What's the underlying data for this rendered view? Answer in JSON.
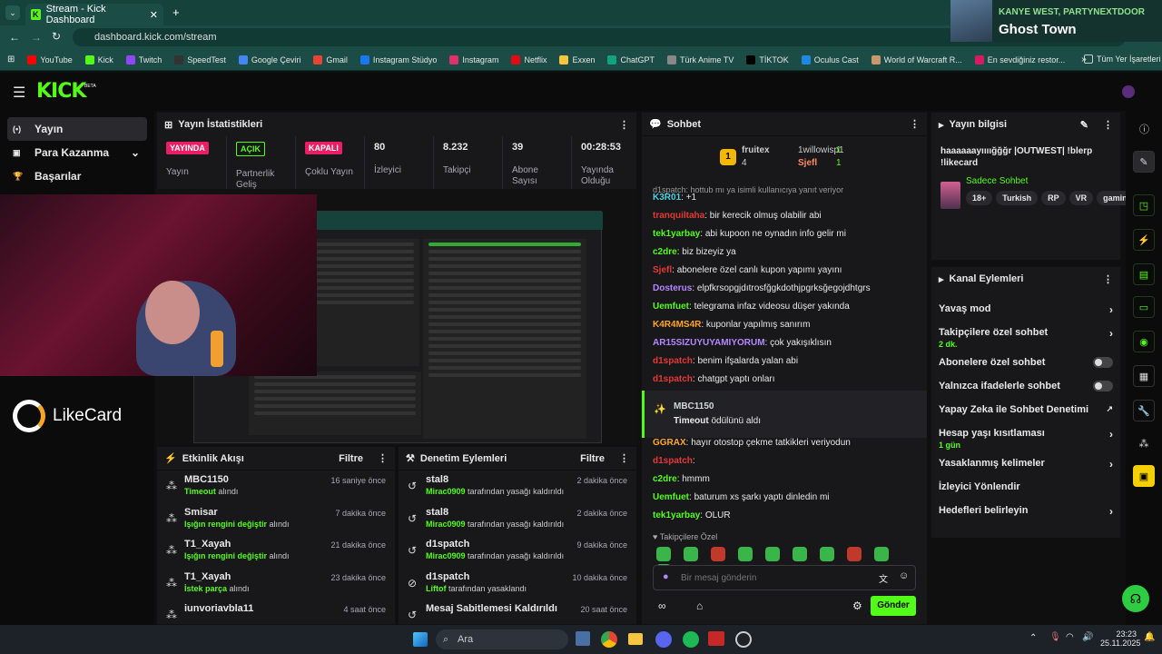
{
  "browser": {
    "tab_title": "Stream - Kick Dashboard",
    "url": "dashboard.kick.com/stream",
    "bookmarks": [
      "YouTube",
      "Kick",
      "Twitch",
      "SpeedTest",
      "Google Çeviri",
      "Gmail",
      "Instagram Stüdyo",
      "Instagram",
      "Netflix",
      "Exxen",
      "ChatGPT",
      "Türk Anime TV",
      "TİKTOK",
      "Oculus Cast",
      "World of Warcraft R...",
      "En sevdiğiniz restor..."
    ],
    "all_bookmarks": "Tüm Yer İşaretleri"
  },
  "media": {
    "artist": "KANYE WEST, PARTYNEXTDOOR",
    "song": "Ghost Town"
  },
  "kick": {
    "logo": "KICK",
    "beta": "BETA"
  },
  "sidebar": {
    "items": [
      {
        "label": "Yayın",
        "icon": "broadcast-icon"
      },
      {
        "label": "Para Kazanma",
        "icon": "wallet-icon"
      },
      {
        "label": "Başarılar",
        "icon": "trophy-icon"
      }
    ]
  },
  "stats": {
    "title": "Yayın İstatistikleri",
    "cells": [
      {
        "badge": "YAYINDA",
        "label": "Yayın",
        "color": "#e91e63"
      },
      {
        "badge": "AÇIK",
        "label": "Partnerlik Geliş",
        "color": "#53fc18"
      },
      {
        "badge": "KAPALI",
        "label": "Çoklu Yayın",
        "color": "#e91e63"
      },
      {
        "value": "80",
        "label": "İzleyici"
      },
      {
        "value": "8.232",
        "label": "Takipçi"
      },
      {
        "value": "39",
        "label": "Abone Sayısı"
      },
      {
        "value": "00:28:53",
        "label": "Yayında Olduğu"
      }
    ]
  },
  "overlay": {
    "brand": "LikeCard"
  },
  "activity": {
    "title": "Etkinlik Akışı",
    "filter": "Filtre",
    "items": [
      {
        "name": "MBC1150",
        "highlight": "Timeout",
        "rest": " alındı",
        "time": "16 saniye önce"
      },
      {
        "name": "Smisar",
        "highlight": "Işığın rengini değiştir",
        "rest": " alındı",
        "time": "7 dakika önce"
      },
      {
        "name": "T1_Xayah",
        "highlight": "Işığın rengini değiştir",
        "rest": " alındı",
        "time": "21 dakika önce"
      },
      {
        "name": "T1_Xayah",
        "highlight": "İstek parça",
        "rest": " alındı",
        "time": "23 dakika önce"
      },
      {
        "name": "iunvoriavbla11",
        "highlight": "",
        "rest": "",
        "time": "4 saat önce"
      }
    ]
  },
  "moderation": {
    "title": "Denetim Eylemleri",
    "filter": "Filtre",
    "items": [
      {
        "name": "stal8",
        "highlight": "Mirac0909",
        "rest": " tarafından yasağı kaldırıldı",
        "time": "2 dakika önce"
      },
      {
        "name": "stal8",
        "highlight": "Mirac0909",
        "rest": " tarafından yasağı kaldırıldı",
        "time": "2 dakika önce"
      },
      {
        "name": "d1spatch",
        "highlight": "Mirac0909",
        "rest": " tarafından yasağı kaldırıldı",
        "time": "9 dakika önce"
      },
      {
        "name": "d1spatch",
        "highlight": "Liftof",
        "rest": " tarafından yasaklandı",
        "time": "10 dakika önce"
      },
      {
        "name": "Mesaj Sabitlemesi Kaldırıldı",
        "highlight": "",
        "rest": "",
        "time": "20 saat önce"
      }
    ]
  },
  "chat": {
    "title": "Sohbet",
    "top": [
      {
        "name": "fruitex",
        "count": "4"
      },
      {
        "name": "1willowisp1",
        "count": "1"
      },
      {
        "name": "Sjefl",
        "count": "1"
      }
    ],
    "reply_hint": "d1spatch: hottub mı ya isimli kullanıcıya yanıt veriyor",
    "messages": [
      {
        "user": "K3R01",
        "color": "#4dd0e1",
        "text": "+1"
      },
      {
        "user": "tranquiltaha",
        "color": "#e53935",
        "text": "bir kerecik olmuş olabilir abi"
      },
      {
        "user": "tek1yarbay",
        "color": "#53fc18",
        "text": "abi kupoon ne oynadın info gelir mi"
      },
      {
        "user": "c2dre",
        "color": "#53fc18",
        "text": "biz bizeyiz ya"
      },
      {
        "user": "Sjefl",
        "color": "#e53935",
        "text": "abonelere özel canlı kupon yapımı yayını"
      },
      {
        "user": "Dosterus",
        "color": "#b388ff",
        "text": "elpfkrsopgjdıtrosfğgkdothjpgrksğegojdhtgrs"
      },
      {
        "user": "Uemfuet",
        "color": "#53fc18",
        "text": "telegrama infaz videosu düşer yakında"
      },
      {
        "user": "K4R4MS4R",
        "color": "#ffa726",
        "text": "kuponlar yapılmış sanırım"
      },
      {
        "user": "AR15SIZUYUYAMIYORUM",
        "color": "#b388ff",
        "text": "çok yakışıklısın"
      },
      {
        "user": "d1spatch",
        "color": "#e53935",
        "text": "benim ifşalarda yalan abi"
      },
      {
        "user": "d1spatch",
        "color": "#e53935",
        "text": "chatgpt yaptı onları"
      }
    ],
    "system": {
      "user": "MBC1150",
      "text1": "Timeout",
      "text2": " ödülünü aldı"
    },
    "messages2": [
      {
        "user": "GGRAX",
        "color": "#ffa726",
        "text": "hayır otostop çekme tatkikleri veriyodun"
      },
      {
        "user": "d1spatch",
        "color": "#e53935",
        "text": ""
      },
      {
        "user": "c2dre",
        "color": "#53fc18",
        "text": "hmmm"
      },
      {
        "user": "Uemfuet",
        "color": "#53fc18",
        "text": "baturum xs şarkı yaptı dinledin mi"
      },
      {
        "user": "tek1yarbay",
        "color": "#53fc18",
        "text": "OLUR"
      }
    ],
    "followers_label": "Takipçilere Özel",
    "placeholder": "Bir mesaj gönderin",
    "send": "Gönder"
  },
  "info": {
    "title": "Yayın bilgisi",
    "stream_title": "haaaaaayıııığğğr |OUTWEST| !blerp !likecard",
    "category": "Sadece Sohbet",
    "tags": [
      "18+",
      "Turkish",
      "RP",
      "VR",
      "gaming"
    ]
  },
  "channel": {
    "title": "Kanal Eylemleri",
    "items": [
      {
        "label": "Yavaş mod",
        "sub": "",
        "type": "arrow"
      },
      {
        "label": "Takipçilere özel sohbet",
        "sub": "2 dk.",
        "type": "arrow"
      },
      {
        "label": "Abonelere özel sohbet",
        "sub": "",
        "type": "toggle"
      },
      {
        "label": "Yalnızca ifadelerle sohbet",
        "sub": "",
        "type": "toggle"
      },
      {
        "label": "Yapay Zeka ile Sohbet Denetimi",
        "sub": "",
        "type": "ext"
      },
      {
        "label": "Hesap yaşı kısıtlaması",
        "sub": "1 gün",
        "type": "arrow"
      },
      {
        "label": "Yasaklanmış kelimeler",
        "sub": "",
        "type": "arrow"
      },
      {
        "label": "İzleyici Yönlendir",
        "sub": "",
        "type": "none"
      },
      {
        "label": "Hedefleri belirleyin",
        "sub": "",
        "type": "arrow"
      }
    ]
  },
  "taskbar": {
    "search": "Ara",
    "time": "23:23",
    "date": "25.11.2025"
  }
}
